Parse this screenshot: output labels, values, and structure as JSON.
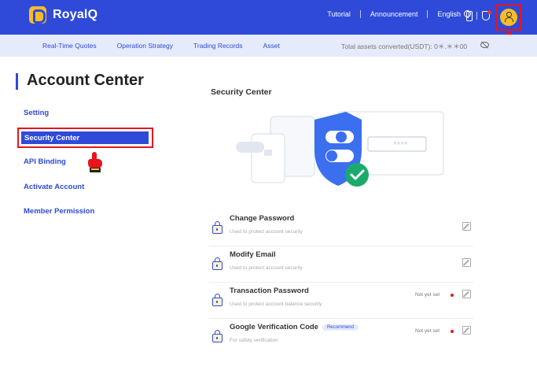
{
  "brand": {
    "name": "RoyalQ"
  },
  "topnav": {
    "tutorial": "Tutorial",
    "announcement": "Announcement",
    "language": "English"
  },
  "subnav": {
    "items": [
      "Real-Time Quotes",
      "Operation Strategy",
      "Trading Records",
      "Asset"
    ],
    "assets_label": "Total assets converted(USDT):",
    "assets_value": "0＊.＊＊00"
  },
  "sidebar": {
    "title": "Account Center",
    "items": [
      {
        "label": "Setting"
      },
      {
        "label": "Security Center",
        "active": true
      },
      {
        "label": "API Binding"
      },
      {
        "label": "Activate Account"
      },
      {
        "label": "Member Permission"
      }
    ]
  },
  "content": {
    "title": "Security Center",
    "illustration_mask": "****",
    "rows": [
      {
        "title": "Change Password",
        "subtitle": "Used to protect account security"
      },
      {
        "title": "Modify Email",
        "subtitle": "Used to protect account security"
      },
      {
        "title": "Transaction Password",
        "subtitle": "Used to protect account balance security",
        "status": "Not yet set"
      },
      {
        "title": "Google Verification Code",
        "badge": "Recommend",
        "subtitle": "For safety verification",
        "status": "Not yet set"
      }
    ]
  },
  "colors": {
    "primary": "#2f4ad9",
    "accent": "#f6bd2a",
    "highlight": "#e8141b",
    "subnav_bg": "#e5ebfb"
  },
  "icons": [
    "logo-icon",
    "globe-icon",
    "phone-icon",
    "shield-icon",
    "avatar-icon",
    "eye-slash-icon",
    "lock-icon",
    "edit-icon",
    "pointer-hand-icon"
  ]
}
